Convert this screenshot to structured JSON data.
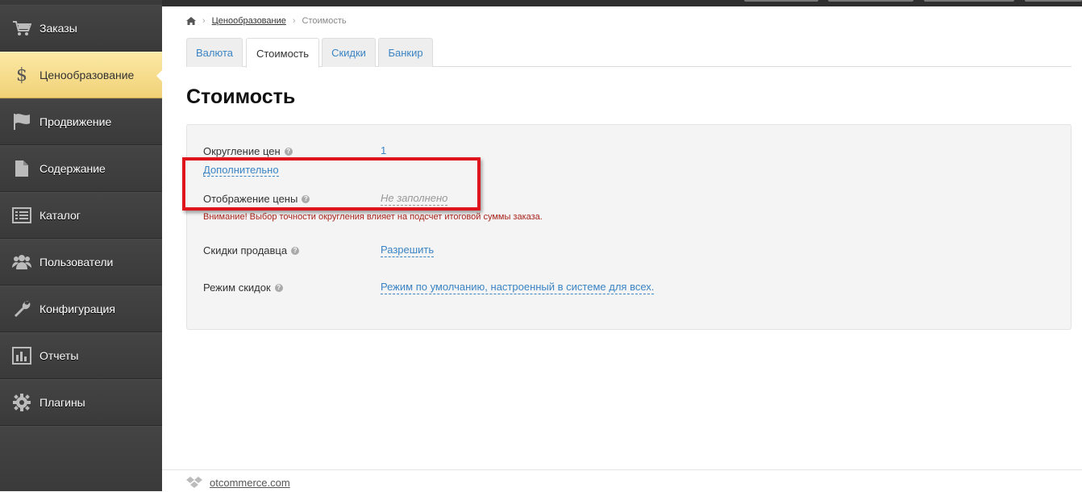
{
  "sidebar": {
    "items": [
      {
        "label": "Заказы",
        "icon": "cart-icon"
      },
      {
        "label": "Ценообразование",
        "icon": "dollar-icon"
      },
      {
        "label": "Продвижение",
        "icon": "flag-icon"
      },
      {
        "label": "Содержание",
        "icon": "document-icon"
      },
      {
        "label": "Каталог",
        "icon": "list-icon"
      },
      {
        "label": "Пользователи",
        "icon": "users-icon"
      },
      {
        "label": "Конфигурация",
        "icon": "wrench-icon"
      },
      {
        "label": "Отчеты",
        "icon": "chart-icon"
      },
      {
        "label": "Плагины",
        "icon": "gear-icon"
      }
    ],
    "dollar_glyph": "$"
  },
  "breadcrumb": {
    "parent": "Ценообразование",
    "current": "Стоимость",
    "separator": "›"
  },
  "tabs": [
    "Валюта",
    "Стоимость",
    "Скидки",
    "Банкир"
  ],
  "page_title": "Стоимость",
  "settings": {
    "rounding_label": "Округление цен",
    "rounding_value": "1",
    "more_link": "Дополнительно",
    "price_display_label": "Отображение цены",
    "price_display_value": "Не заполнено",
    "warning": "Внимание! Выбор точности округления влияет на подсчет итоговой суммы заказа.",
    "seller_discount_label": "Скидки продавца",
    "seller_discount_value": "Разрешить",
    "discount_mode_label": "Режим скидок",
    "discount_mode_value": "Режим по умолчанию, настроенный в системе для всех."
  },
  "help_glyph": "?",
  "footer": {
    "link": "otcommerce.com"
  },
  "colors": {
    "accent": "#3b84c4",
    "warning": "#a8231b",
    "highlight": "#e0141c",
    "active_nav": "#f1d176"
  }
}
